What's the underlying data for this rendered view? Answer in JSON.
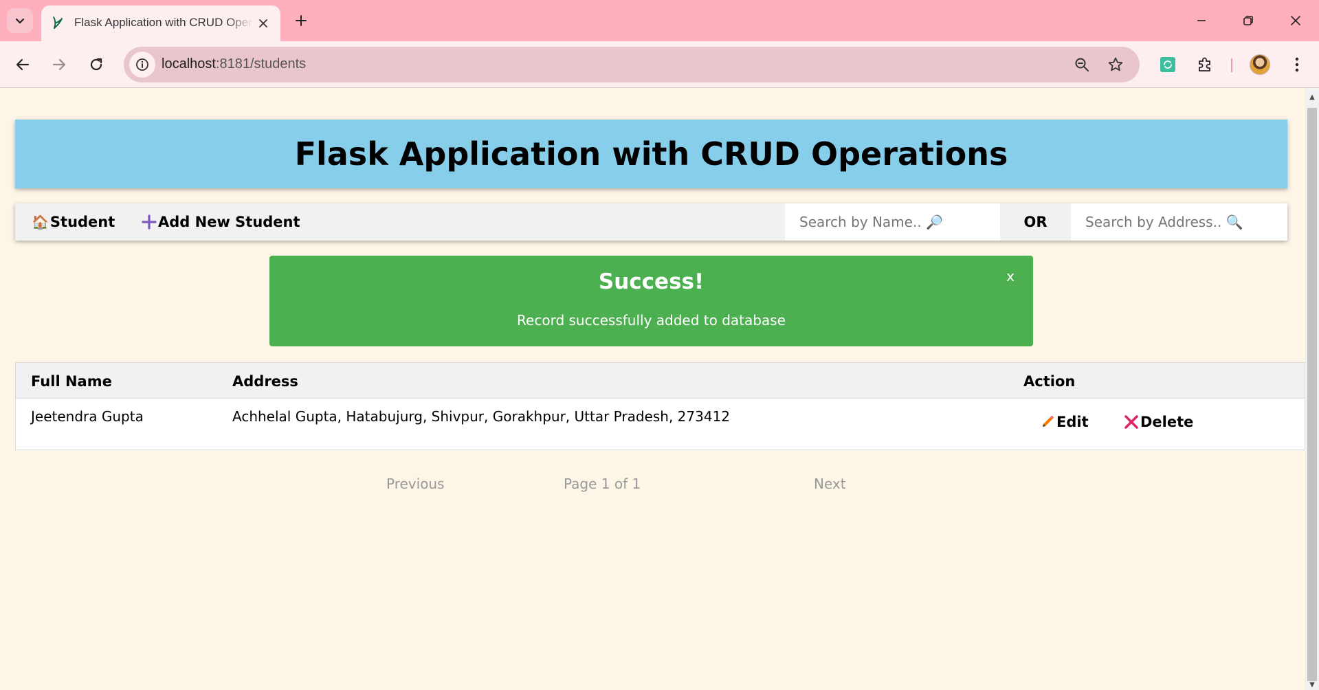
{
  "browser": {
    "tab_title": "Flask Application with CRUD Operations",
    "url_host": "localhost",
    "url_path": ":8181/students"
  },
  "page": {
    "header_title": "Flask Application with CRUD Operations",
    "nav": {
      "home_label": "Student",
      "add_label": "Add New Student",
      "search_name_placeholder": "Search by Name.. 🔎",
      "or_label": "OR",
      "search_address_placeholder": "Search by Address.. 🔍"
    },
    "alert": {
      "title": "Success!",
      "message": "Record successfully added to database",
      "close": "x"
    },
    "table": {
      "columns": [
        "Full Name",
        "Address",
        "Action"
      ],
      "rows": [
        {
          "name": "Jeetendra Gupta",
          "address": "Achhelal Gupta, Hatabujurg, Shivpur, Gorakhpur, Uttar Pradesh, 273412",
          "edit_label": "Edit",
          "delete_label": "Delete"
        }
      ]
    },
    "pagination": {
      "previous": "Previous",
      "page_info": "Page 1 of 1",
      "next": "Next"
    }
  },
  "colors": {
    "tab_strip": "#ffaebc",
    "header_bg": "#87ceeb",
    "alert_bg": "#4caf50",
    "page_bg": "#fdf5e6"
  }
}
